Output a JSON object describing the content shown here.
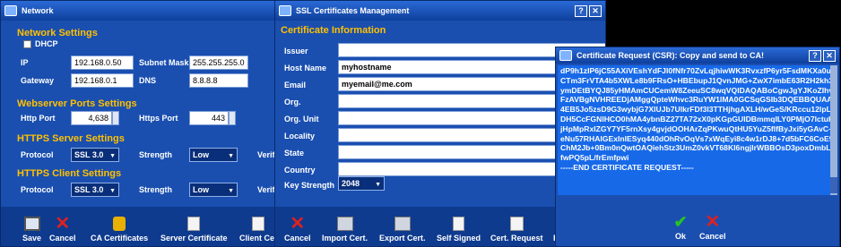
{
  "network": {
    "title": "Network",
    "sections": {
      "network_settings": "Network Settings",
      "webserver_ports": "Webserver Ports Settings",
      "https_server": "HTTPS Server Settings",
      "https_client": "HTTPS Client Settings"
    },
    "dhcp_label": "DHCP",
    "ip_label": "IP",
    "ip_value": "192.168.0.50",
    "subnet_label": "Subnet Mask",
    "subnet_value": "255.255.255.0",
    "gateway_label": "Gateway",
    "gateway_value": "192.168.0.1",
    "dns_label": "DNS",
    "dns_value": "8.8.8.8",
    "http_port_label": "Http Port",
    "http_port_value": "4,638",
    "https_port_label": "Https Port",
    "https_port_value": "443",
    "protocol_label": "Protocol",
    "protocol_value": "SSL 3.0",
    "strength_label": "Strength",
    "strength_value": "Low",
    "verify_label": "Verif",
    "client_protocol_value": "SSL 3.0",
    "client_strength_value": "Low",
    "toolbar": {
      "save": "Save",
      "cancel": "Cancel",
      "ca_certificates": "CA Certificates",
      "server_certificate": "Server Certificate",
      "client_cert": "Client Cer"
    }
  },
  "ssl": {
    "title": "SSL Certificates Management",
    "section": "Certificate Information",
    "fields": {
      "issuer": "Issuer",
      "host_name": "Host Name",
      "email": "Email",
      "org": "Org.",
      "org_unit": "Org. Unit",
      "locality": "Locality",
      "state": "State",
      "country": "Country",
      "key_strength": "Key Strength"
    },
    "host_name_value": "myhostname",
    "email_value": "myemail@me.com",
    "key_strength_value": "2048",
    "toolbar": {
      "cancel": "Cancel",
      "import": "Import Cert.",
      "export": "Export Cert.",
      "self_signed": "Self Signed",
      "request": "Cert. Request",
      "r": "R"
    }
  },
  "csr": {
    "title": "Certificate Request (CSR): Copy and send to CA!",
    "lines": [
      "dP9h1zIP6jC55AXiVEshYdFJl0fNfr70ZvLqjhiwWK3RvxzfP6yr5FsdMKXa0u5i",
      "CTm3FrVTA4b5XWLe8b9FRsO+HBEbupJ1QvnJMG+ZwX7imbE63R2H2kh3",
      "ymDEtBYQJ85yHMAmCUCemW8ZeeuSC8wqVQIDAQABoCgwJgYJKoZIhvcN",
      "FzAVBgNVHREEDjAMggQpteWhvc3RuYW1lMA0GCSqGSIb3DQEBBQUAA4IBA",
      "4EB5Jo5zsD9G3wybjG7XlUJb7UlkrFDf3l3TTHjhgAXLH/wGeS/KRccu12lpLX9",
      "DH5CcFGNlHCO0hMA4ybnBZ27TA72xX0pKGpGUIDBmmqILY0PMjO7lctuKSI",
      "jHpMpRxIZGY7YF5rnXsy4gvjdOOHArZqPKwuQtHU5YuZ5flfByJxi5yGAvC+",
      "eNu57RHAlGExInlESyq440dOhRvOqVs7xWqEyi8c4w1rDJ8+7d5bFC6CoE97",
      "ChM2Jb+0Bm0nQwtOAQiehStz3UmZ0vkVT68Kl6ngjlrWBBOsD3poxDmbL2",
      "fwPQ5pL/frEmfpwi"
    ],
    "end_line": "-----END CERTIFICATE REQUEST-----",
    "ok": "Ok",
    "cancel": "Cancel"
  }
}
